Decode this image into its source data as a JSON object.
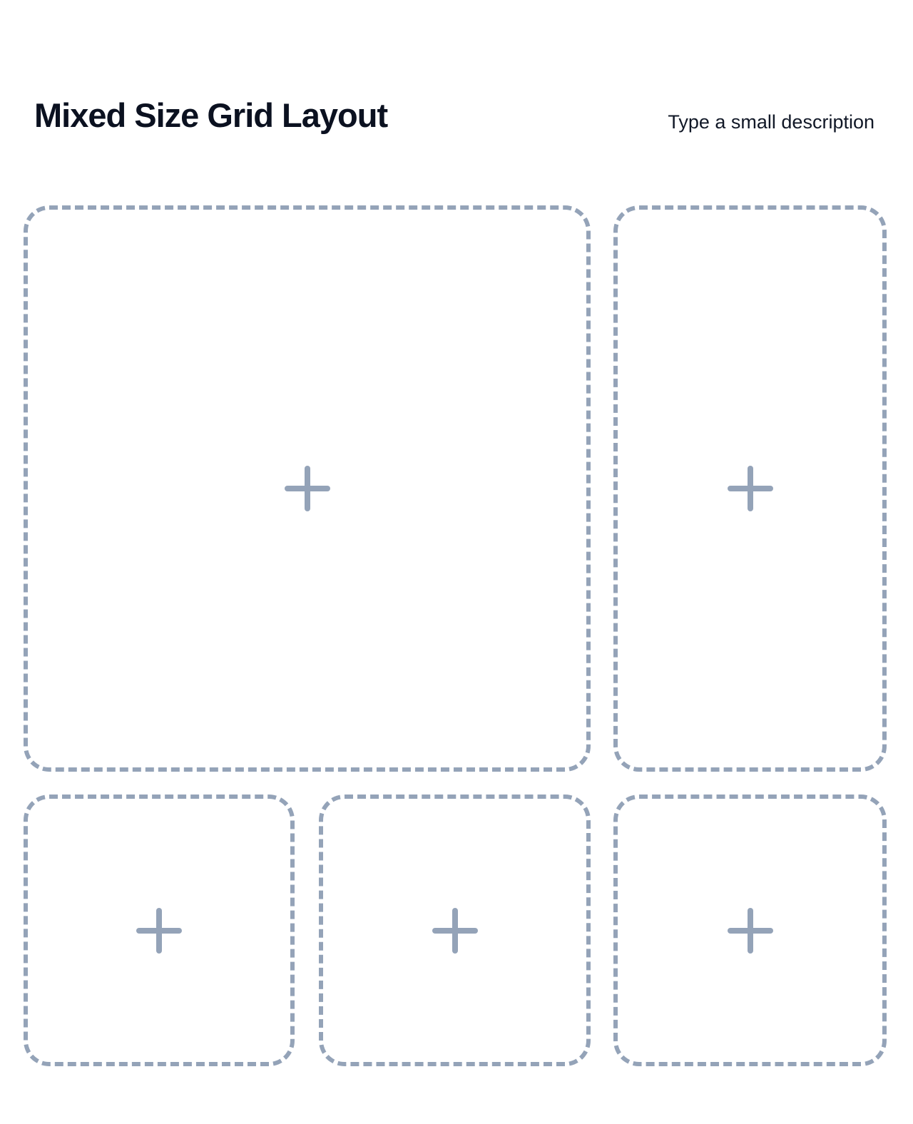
{
  "header": {
    "title": "Mixed Size Grid Layout",
    "description": "Type a small description"
  },
  "grid": {
    "slots": [
      {
        "icon": "plus-icon",
        "size": "large"
      },
      {
        "icon": "plus-icon",
        "size": "tall"
      },
      {
        "icon": "plus-icon",
        "size": "small"
      },
      {
        "icon": "plus-icon",
        "size": "small"
      },
      {
        "icon": "plus-icon",
        "size": "small"
      }
    ]
  },
  "colors": {
    "dashed_border": "#94a3b8",
    "title_text": "#0b1120",
    "background": "#ffffff"
  }
}
